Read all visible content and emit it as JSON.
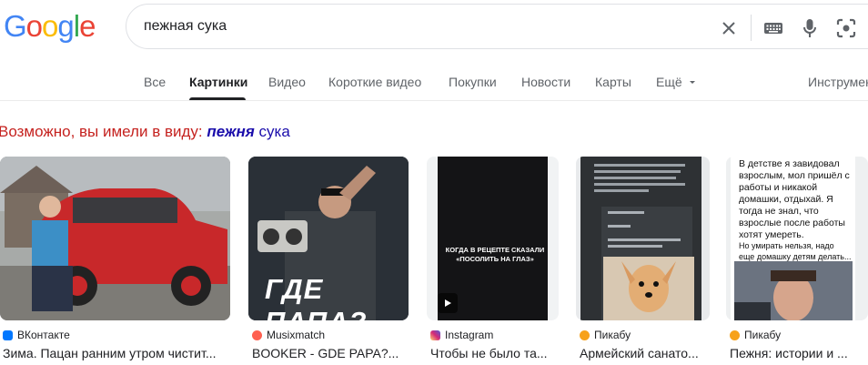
{
  "logo": {
    "letters": [
      "G",
      "o",
      "o",
      "g",
      "l",
      "e"
    ],
    "colors": [
      "#4285f4",
      "#ea4335",
      "#fbbc05",
      "#4285f4",
      "#34a853",
      "#ea4335"
    ]
  },
  "search": {
    "value": "пежная сука"
  },
  "tabs": [
    {
      "label": "Все"
    },
    {
      "label": "Картинки"
    },
    {
      "label": "Видео"
    },
    {
      "label": "Короткие видео"
    },
    {
      "label": "Покупки"
    },
    {
      "label": "Новости"
    },
    {
      "label": "Карты"
    },
    {
      "label": "Ещё"
    },
    {
      "label": "Инструменты"
    }
  ],
  "suggestion": {
    "prefix": "Возможно, вы имели в виду:",
    "bold": "пежня",
    "rest": "сука"
  },
  "results": [
    {
      "source": "ВКонтакте",
      "title": "Зима. Пацан ранним утром чистит...",
      "fav_color": "#0077ff"
    },
    {
      "source": "Musixmatch",
      "title": "BOOKER - GDE PAPA?...",
      "fav_color": "#ff6050",
      "overlay": "ГДЕ ПАПА?"
    },
    {
      "source": "Instagram",
      "title": "Чтобы не было та...",
      "fav_color": "#d62976",
      "overlay": "КОГДА В РЕЦЕПТЕ СКАЗАЛИ «ПОСОЛИТЬ НА ГЛАЗ»"
    },
    {
      "source": "Пикабу",
      "title": "Армейский санато...",
      "fav_color": "#f7a21b"
    },
    {
      "source": "Пикабу",
      "title": "Пежня: истории и ...",
      "fav_color": "#f7a21b",
      "meme": "В детстве я завидовал взрослым, мол пришёл с работы и никакой домашки, отдыхай. Я тогда не знал, что взрослые после работы хотят умереть.",
      "meme2": "Но умирать нельзя, надо еще домашку детям делать..."
    }
  ]
}
